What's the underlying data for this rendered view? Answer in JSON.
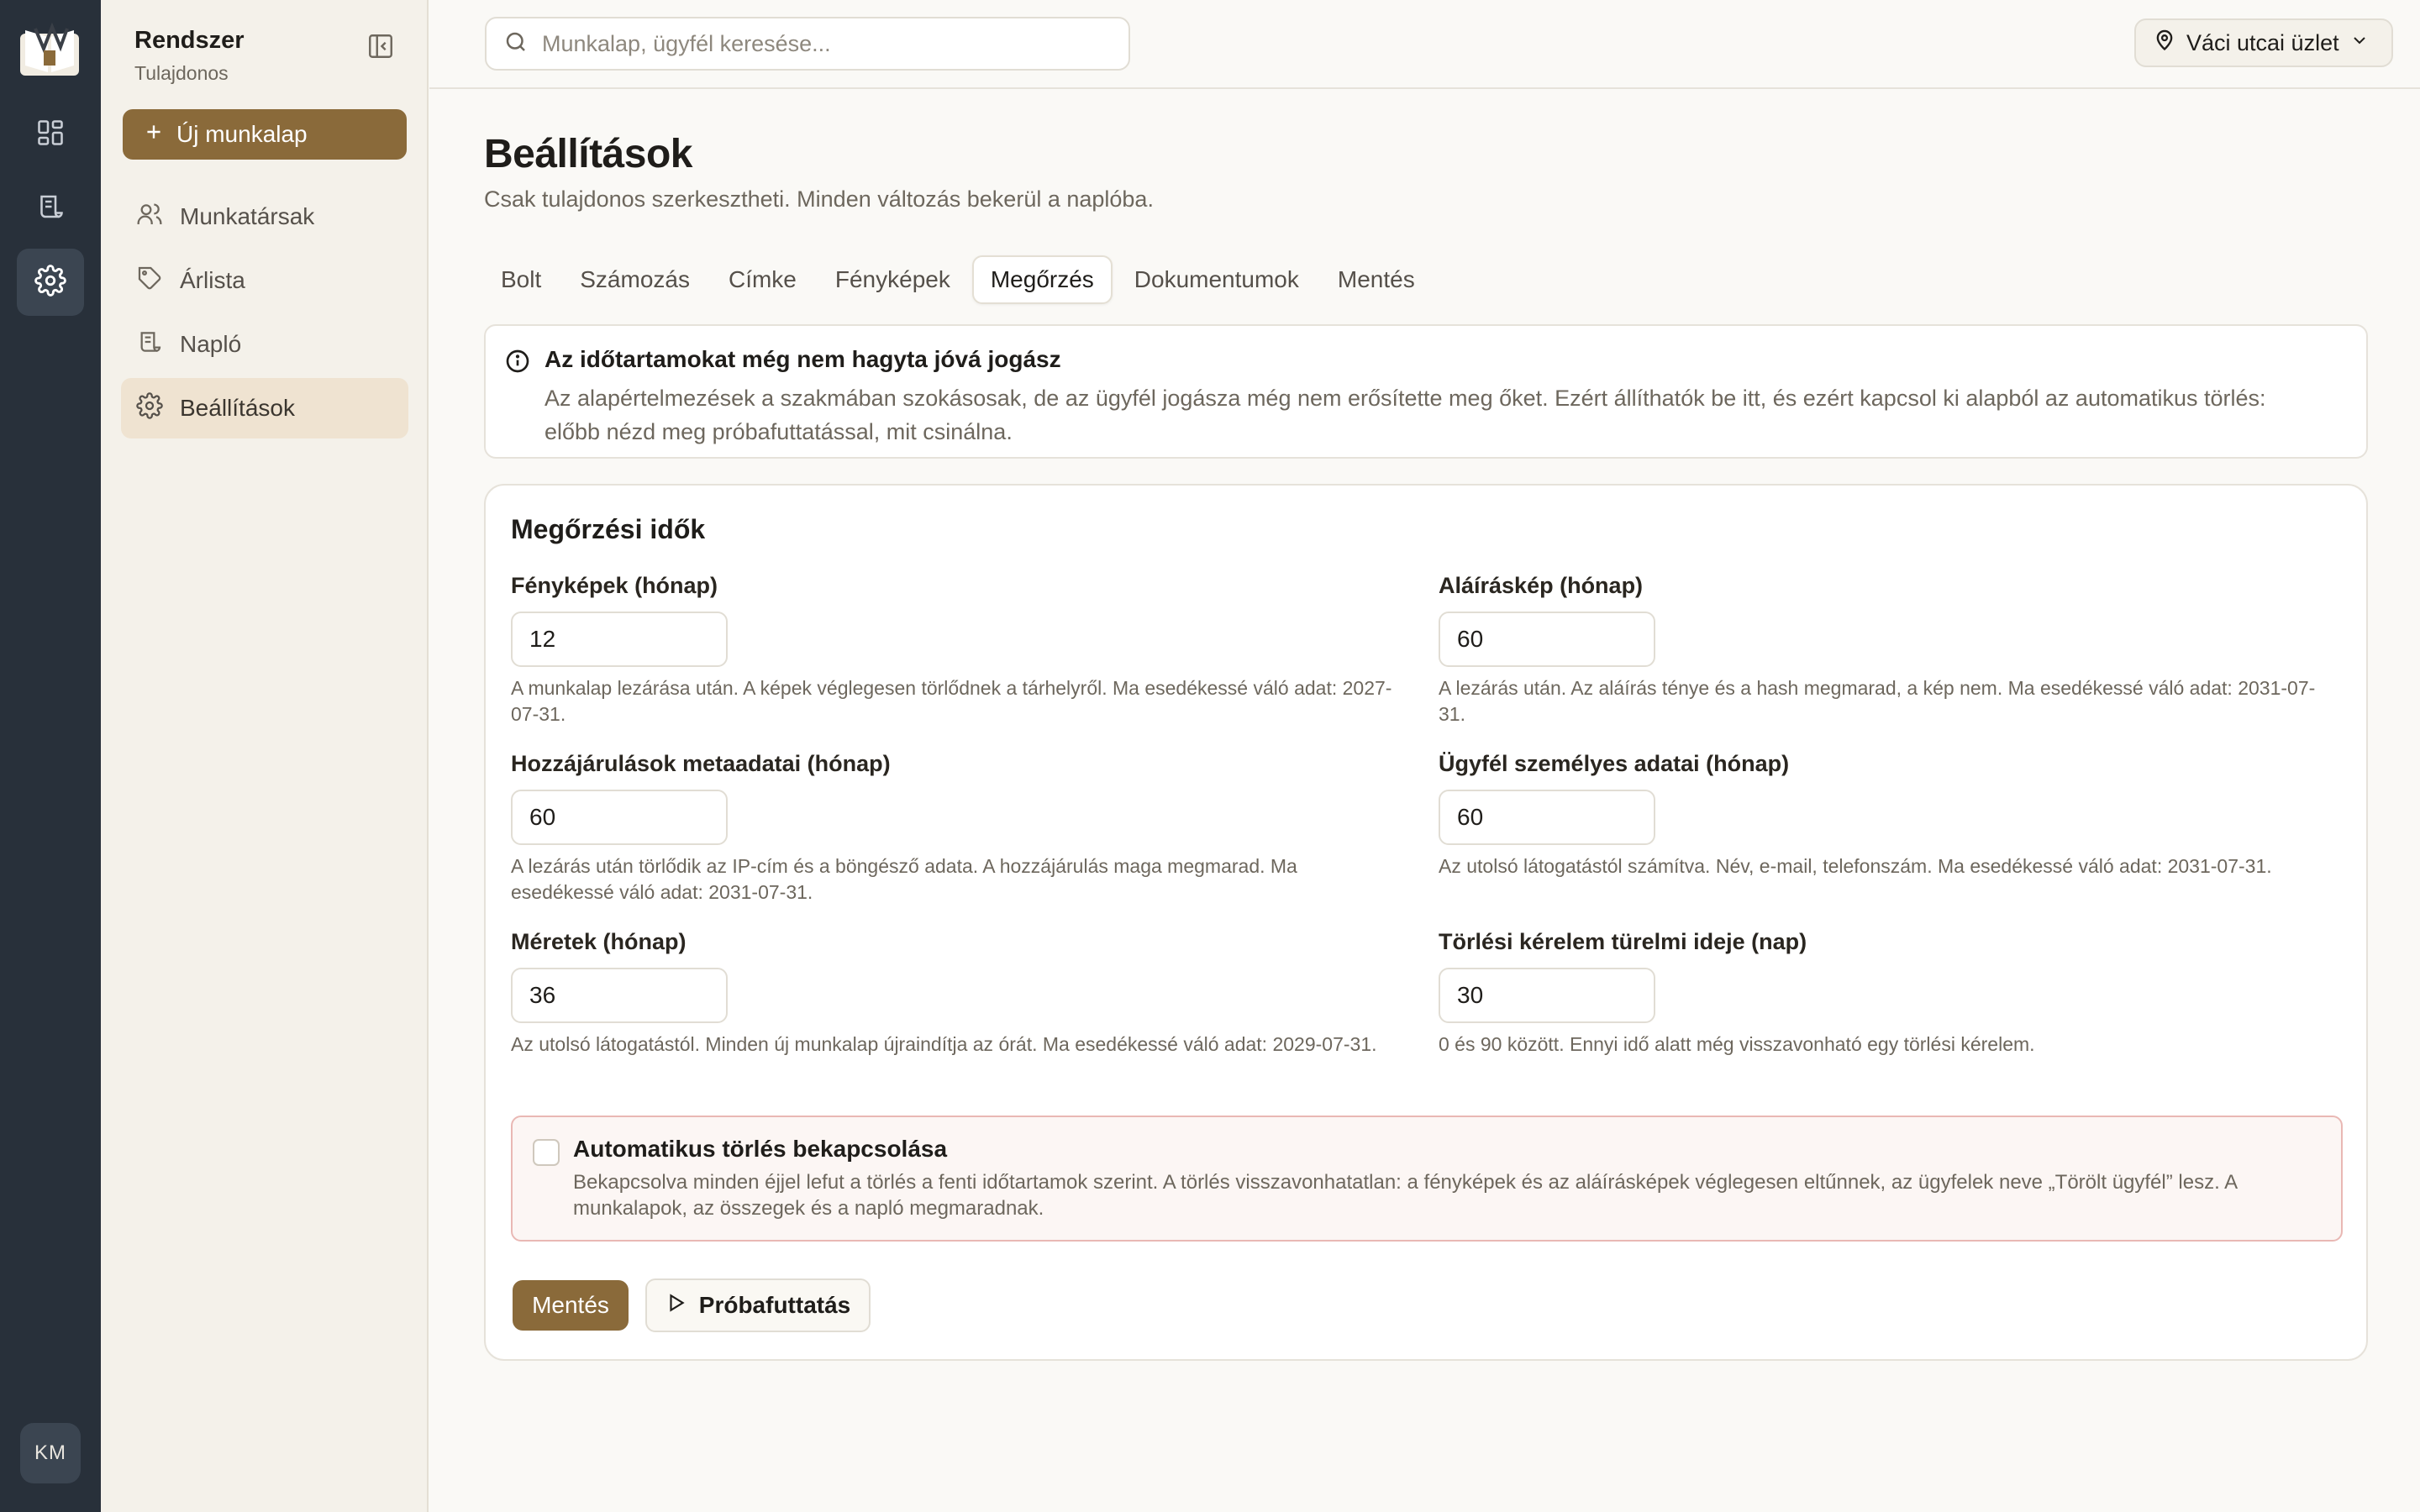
{
  "rail": {
    "icons": [
      "dashboard-icon",
      "worksheets-icon",
      "settings-icon"
    ],
    "avatar_initials": "KM"
  },
  "sidebar": {
    "title": "Rendszer",
    "subtitle": "Tulajdonos",
    "new_button": "Új munkalap",
    "items": [
      {
        "label": "Munkatársak",
        "icon": "users-icon"
      },
      {
        "label": "Árlista",
        "icon": "tag-icon"
      },
      {
        "label": "Napló",
        "icon": "scroll-icon"
      },
      {
        "label": "Beállítások",
        "icon": "gear-icon",
        "active": true
      }
    ]
  },
  "topbar": {
    "search_placeholder": "Munkalap, ügyfél keresése...",
    "store_label": "Váci utcai üzlet"
  },
  "page": {
    "title": "Beállítások",
    "subtitle": "Csak tulajdonos szerkesztheti. Minden változás bekerül a naplóba."
  },
  "tabs": [
    {
      "label": "Bolt"
    },
    {
      "label": "Számozás"
    },
    {
      "label": "Címke"
    },
    {
      "label": "Fényképek"
    },
    {
      "label": "Megőrzés",
      "active": true
    },
    {
      "label": "Dokumentumok"
    },
    {
      "label": "Mentés"
    }
  ],
  "notice": {
    "title": "Az időtartamokat még nem hagyta jóvá jogász",
    "body": "Az alapértelmezések a szakmában szokásosak, de az ügyfél jogásza még nem erősítette meg őket. Ezért állíthatók be itt, és ezért kapcsol ki alapból az automatikus törlés: előbb nézd meg próbafuttatással, mit csinálna."
  },
  "retention": {
    "title": "Megőrzési idők",
    "fields": [
      {
        "label": "Fényképek (hónap)",
        "value": "12",
        "help": "A munkalap lezárása után. A képek véglegesen törlődnek a tárhelyről. Ma esedékessé váló adat: 2027-07-31."
      },
      {
        "label": "Aláíráskép (hónap)",
        "value": "60",
        "help": "A lezárás után. Az aláírás ténye és a hash megmarad, a kép nem. Ma esedékessé váló adat: 2031-07-31."
      },
      {
        "label": "Hozzájárulások metaadatai (hónap)",
        "value": "60",
        "help": "A lezárás után törlődik az IP-cím és a böngésző adata. A hozzájárulás maga megmarad. Ma esedékessé váló adat: 2031-07-31."
      },
      {
        "label": "Ügyfél személyes adatai (hónap)",
        "value": "60",
        "help": "Az utolsó látogatástól számítva. Név, e-mail, telefonszám. Ma esedékessé váló adat: 2031-07-31."
      },
      {
        "label": "Méretek (hónap)",
        "value": "36",
        "help": "Az utolsó látogatástól. Minden új munkalap újraindítja az órát. Ma esedékessé váló adat: 2029-07-31."
      },
      {
        "label": "Törlési kérelem türelmi ideje (nap)",
        "value": "30",
        "help": "0 és 90 között. Ennyi idő alatt még visszavonható egy törlési kérelem."
      }
    ],
    "auto_delete": {
      "title": "Automatikus törlés bekapcsolása",
      "body": "Bekapcsolva minden éjjel lefut a törlés a fenti időtartamok szerint. A törlés visszavonhatatlan: a fényképek és az aláírásképek véglegesen eltűnnek, az ügyfelek neve „Törölt ügyfél” lesz. A munkalapok, az összegek és a napló megmaradnak.",
      "checked": false
    },
    "save_button": "Mentés",
    "dry_run_button": "Próbafuttatás"
  },
  "colors": {
    "rail_bg": "#28303a",
    "accent": "#8a6a3a",
    "active_nav_bg": "#efe3d1",
    "danger_border": "#e9b8b4"
  }
}
